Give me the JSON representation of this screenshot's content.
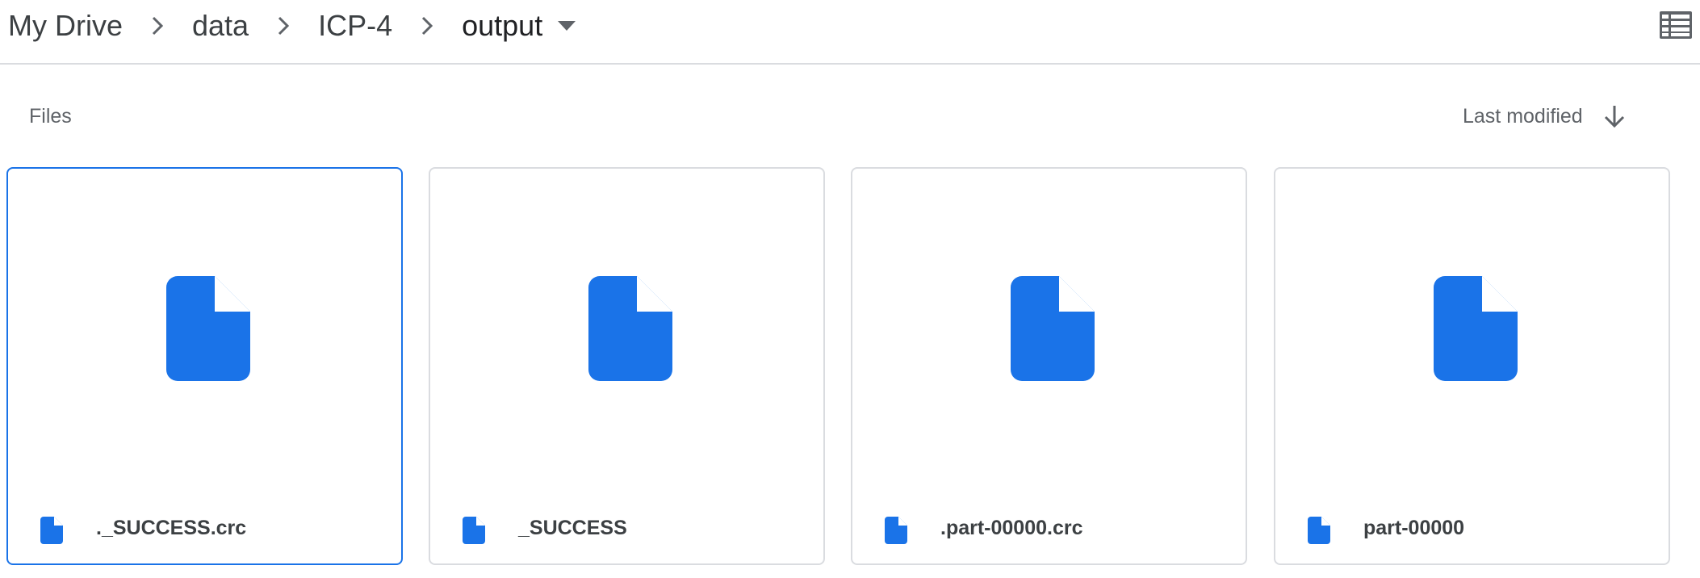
{
  "breadcrumb": {
    "items": [
      "My Drive",
      "data",
      "ICP-4",
      "output"
    ],
    "current_menu_icon": "caret-down-icon",
    "separator_icon": "chevron-right-icon"
  },
  "toolbar": {
    "view_toggle_icon": "list-view-icon"
  },
  "section": {
    "files_label": "Files",
    "sort_label": "Last modified",
    "sort_icon": "arrow-down-icon"
  },
  "files": [
    {
      "name": "._SUCCESS.crc",
      "selected": true
    },
    {
      "name": "_SUCCESS",
      "selected": false
    },
    {
      "name": ".part-00000.crc",
      "selected": false
    },
    {
      "name": "part-00000",
      "selected": false
    }
  ],
  "colors": {
    "accent": "#1a73e8",
    "file_icon": "#1a73e8",
    "border": "#dadce0",
    "text_primary": "#202124",
    "text_secondary": "#5f6368"
  }
}
